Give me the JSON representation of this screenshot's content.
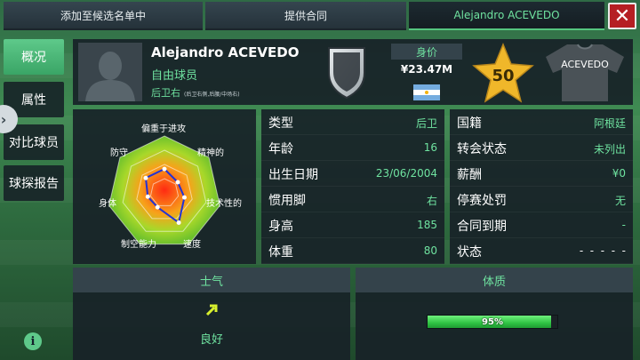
{
  "tabs": [
    {
      "label": "添加至候选名单中"
    },
    {
      "label": "提供合同"
    },
    {
      "label": "Alejandro ACEVEDO"
    }
  ],
  "close_label": "✕",
  "nav": {
    "items": [
      {
        "label": "概况",
        "active": true
      },
      {
        "label": "属性",
        "active": false
      },
      {
        "label": "对比球员",
        "active": false
      },
      {
        "label": "球探报告",
        "active": false
      }
    ]
  },
  "player": {
    "name": "Alejandro ACEVEDO",
    "status": "自由球员",
    "position": "后卫右",
    "position_detail": "(后卫右侧,后腰/中场右)",
    "value_label": "身价",
    "value": "¥23.47M",
    "rating": "50",
    "shirt_name": "ACEVEDO",
    "nationality_flag": "argentina-flag-icon"
  },
  "radar": {
    "labels": [
      "偏重于进攻",
      "精神的",
      "技术性的",
      "速度",
      "制空能力",
      "身体",
      "防守"
    ],
    "values": [
      0.42,
      0.3,
      0.36,
      0.58,
      0.28,
      0.3,
      0.42
    ]
  },
  "info_left": [
    {
      "key": "类型",
      "value": "后卫"
    },
    {
      "key": "年龄",
      "value": "16"
    },
    {
      "key": "出生日期",
      "value": "23/06/2004"
    },
    {
      "key": "惯用脚",
      "value": "右"
    },
    {
      "key": "身高",
      "value": "185"
    },
    {
      "key": "体重",
      "value": "80"
    }
  ],
  "info_right": [
    {
      "key": "国籍",
      "value": "阿根廷"
    },
    {
      "key": "转会状态",
      "value": "未列出"
    },
    {
      "key": "薪酬",
      "value": "¥0"
    },
    {
      "key": "停赛处罚",
      "value": "无"
    },
    {
      "key": "合同到期",
      "value": "-"
    },
    {
      "key": "状态",
      "value": "-  -  -  -  -"
    }
  ],
  "morale": {
    "title": "士气",
    "value": "良好"
  },
  "fitness": {
    "title": "体质",
    "value_text": "95%",
    "fraction": 0.95
  },
  "colors": {
    "accent": "#6fe3a0",
    "panel": "#182228",
    "danger": "#b51e23",
    "star": "#f0b72a"
  }
}
